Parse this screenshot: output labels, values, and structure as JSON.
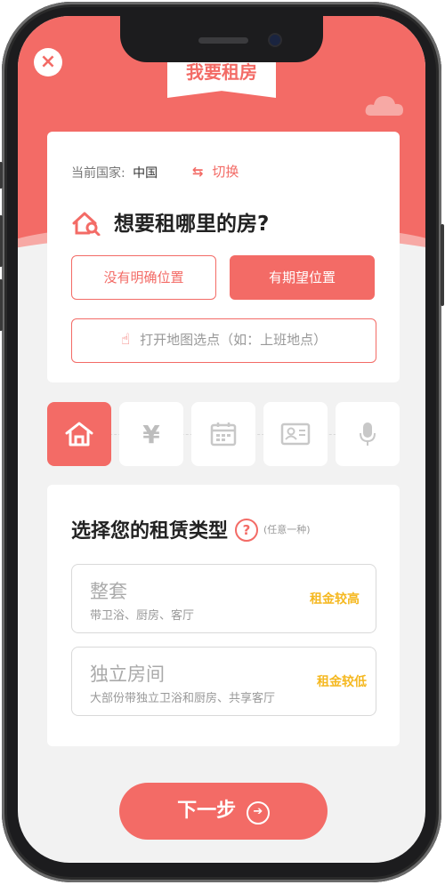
{
  "header": {
    "close_icon": "×",
    "title": "我要租房"
  },
  "location": {
    "country_label": "当前国家:",
    "country_value": "中国",
    "switch_icon": "⇆",
    "switch_label": "切换"
  },
  "question": {
    "icon": "house-search-icon",
    "title": "想要租哪里的房?",
    "options": [
      {
        "label": "没有明确位置",
        "selected": false
      },
      {
        "label": "有期望位置",
        "selected": true
      }
    ],
    "map_picker": "打开地图选点（如：上班地点）",
    "map_icon": "hand-pointer-icon"
  },
  "steps": [
    {
      "icon": "home-icon",
      "active": true
    },
    {
      "icon": "yen-icon",
      "glyph": "¥",
      "active": false
    },
    {
      "icon": "calendar-icon",
      "active": false
    },
    {
      "icon": "id-card-icon",
      "active": false
    },
    {
      "icon": "microphone-icon",
      "active": false
    }
  ],
  "rental_type": {
    "title": "选择您的租赁类型",
    "help_icon": "?",
    "hint": "(任意一种)",
    "options": [
      {
        "name": "整套",
        "desc": "带卫浴、厨房、客厅",
        "price": "租金较高"
      },
      {
        "name": "独立房间",
        "desc": "大部份带独立卫浴和厨房、共享客厅",
        "price": "租金较低"
      }
    ]
  },
  "next_button": {
    "label": "下一步",
    "arrow": "➔"
  },
  "colors": {
    "accent": "#f36b66",
    "price": "#f5b820",
    "background": "#f2f2f2"
  }
}
